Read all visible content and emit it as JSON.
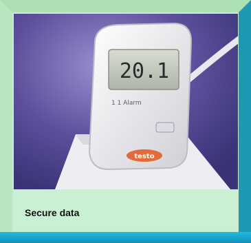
{
  "caption": {
    "text": "Secure data"
  },
  "photo": {
    "display_reading": "20.1",
    "device_label": "1 1 Alarm",
    "brand_logo": "testo"
  },
  "colors": {
    "frame_light": "#b9e6c1",
    "frame_dark": "#1f98b3",
    "panel": "#c9f0d3",
    "bottom_bar": "#1aa8cf"
  }
}
